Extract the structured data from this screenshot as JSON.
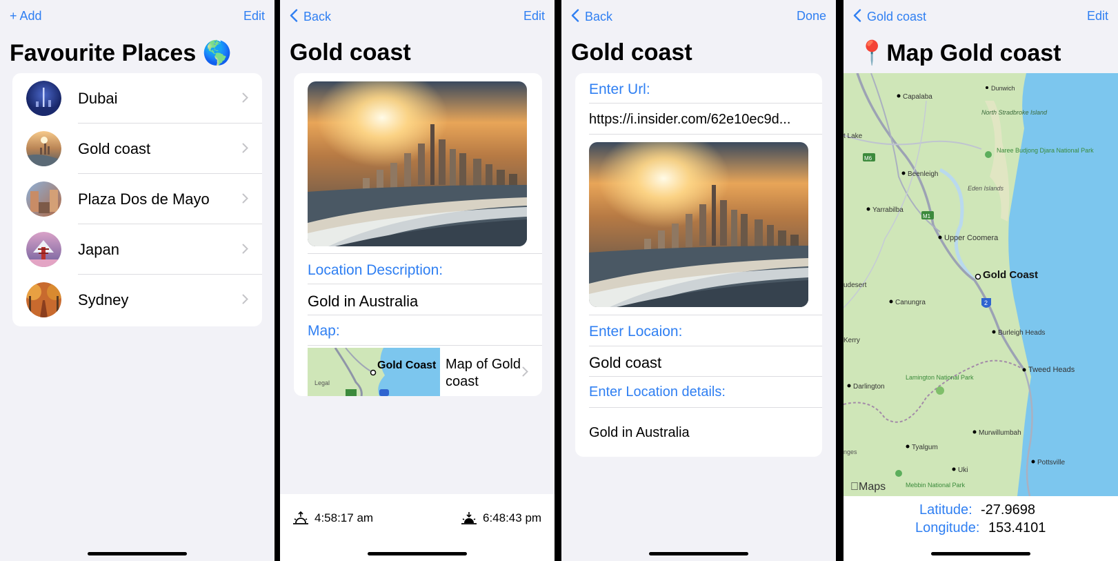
{
  "list_screen": {
    "add_label": "+ Add",
    "edit_label": "Edit",
    "title": "Favourite Places 🌎",
    "places": [
      {
        "name": "Dubai"
      },
      {
        "name": "Gold coast"
      },
      {
        "name": "Plaza Dos de Mayo"
      },
      {
        "name": "Japan"
      },
      {
        "name": "Sydney"
      }
    ]
  },
  "detail_screen": {
    "back_label": "Back",
    "edit_label": "Edit",
    "title": "Gold coast",
    "description_label": "Location Description:",
    "description_value": "Gold in Australia",
    "map_label": "Map:",
    "map_thumb_city": "Gold Coast",
    "map_thumb_legal": "Legal",
    "map_link_text": "Map of Gold coast",
    "sunrise_time": "4:58:17 am",
    "sunset_time": "6:48:43 pm"
  },
  "edit_screen": {
    "back_label": "Back",
    "done_label": "Done",
    "title": "Gold coast",
    "url_label": "Enter Url:",
    "url_value": "https://i.insider.com/62e10ec9d...",
    "location_label": "Enter Locaion:",
    "location_value": "Gold coast",
    "details_label": "Enter Location details:",
    "details_value": "Gold in Australia"
  },
  "map_screen": {
    "back_label": "Gold coast",
    "edit_label": "Edit",
    "title": "📍Map Gold coast",
    "places": {
      "capalaba": "Capalaba",
      "dunwich": "Dunwich",
      "north_stradbroke": "North Stradbroke Island",
      "lake": "t Lake",
      "naree": "Naree Budjong Djara National Park",
      "beenleigh": "Beenleigh",
      "eden": "Eden Islands",
      "yarrabilba": "Yarrabilba",
      "upper_coomera": "Upper Coomera",
      "gold_coast": "Gold Coast",
      "udesert": "udesert",
      "canungra": "Canungra",
      "burleigh": "Burleigh Heads",
      "kerry": "Kerry",
      "tweed": "Tweed Heads",
      "darlington": "Darlington",
      "lamington": "Lamington National Park",
      "murwillumbah": "Murwillumbah",
      "tyalgum": "Tyalgum",
      "pottsville": "Pottsville",
      "uki": "Uki",
      "mebbin": "Mebbin National Park",
      "ranges": "nges"
    },
    "road_labels": {
      "m6": "M6",
      "m1": "M1",
      "r2": "2"
    },
    "maps_brand": "Maps",
    "latitude_label": "Latitude:",
    "latitude_value": "-27.9698",
    "longitude_label": "Longitude:",
    "longitude_value": "153.4101"
  },
  "colors": {
    "accent": "#2f7ff2",
    "background": "#f2f2f7",
    "card": "#ffffff",
    "water": "#7cc6ee",
    "land": "#cfe6b8"
  }
}
